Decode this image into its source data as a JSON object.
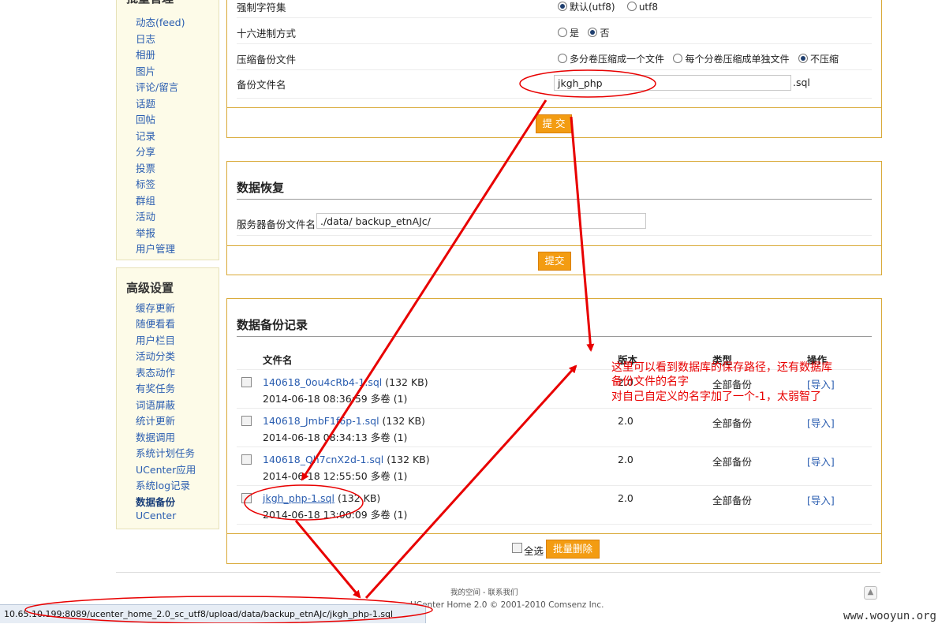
{
  "sidebar": {
    "batch_title": "批量管理",
    "batch_items": [
      "动态(feed)",
      "日志",
      "相册",
      "图片",
      "评论/留言",
      "话题",
      "回帖",
      "记录",
      "分享",
      "投票",
      "标签",
      "群组",
      "活动",
      "举报",
      "用户管理"
    ],
    "advanced_title": "高级设置",
    "advanced_items": [
      "缓存更新",
      "随便看看",
      "用户栏目",
      "活动分类",
      "表态动作",
      "有奖任务",
      "词语屏蔽",
      "统计更新",
      "数据调用",
      "系统计划任务",
      "UCenter应用",
      "系统log记录",
      "数据备份",
      "UCenter"
    ],
    "current_item": "数据备份"
  },
  "backup": {
    "charset_label": "强制字符集",
    "charset_opt1": "默认(utf8)",
    "charset_opt2": "utf8",
    "hex_label": "十六进制方式",
    "hex_yes": "是",
    "hex_no": "否",
    "compress_label": "压缩备份文件",
    "compress_opt1": "多分卷压缩成一个文件",
    "compress_opt2": "每个分卷压缩成单独文件",
    "compress_opt3": "不压缩",
    "filename_label": "备份文件名",
    "filename_value": "jkgh_php",
    "filename_suffix": ".sql",
    "submit": "提 交"
  },
  "restore": {
    "title": "数据恢复",
    "path_label": "服务器备份文件名:",
    "path_value": "./data/ backup_etnAJc/",
    "submit": "提交"
  },
  "records": {
    "title": "数据备份记录",
    "headers": {
      "filename": "文件名",
      "version": "版本",
      "type": "类型",
      "action": "操作"
    },
    "rows": [
      {
        "file": "140618_0ou4cRb4-1.sql",
        "size": "(132 KB)",
        "date": "2014-06-18 08:36:59 多卷 (1)",
        "version": "2.0",
        "type": "全部备份",
        "action": "[导入]"
      },
      {
        "file": "140618_JmbF1f6p-1.sql",
        "size": "(132 KB)",
        "date": "2014-06-18 08:34:13 多卷 (1)",
        "version": "2.0",
        "type": "全部备份",
        "action": "[导入]"
      },
      {
        "file": "140618_Qh7cnX2d-1.sql",
        "size": "(132 KB)",
        "date": "2014-06-18 12:55:50 多卷 (1)",
        "version": "2.0",
        "type": "全部备份",
        "action": "[导入]"
      },
      {
        "file": "jkgh_php-1.sql",
        "size": "(132 KB)",
        "date": "2014-06-18 13:00:09 多卷 (1)",
        "version": "2.0",
        "type": "全部备份",
        "action": "[导入]"
      }
    ],
    "select_all": "全选",
    "batch_delete": "批量删除"
  },
  "footer": {
    "links": "我的空间 - 联系我们",
    "powered": "UCenter Home 2.0 © 2001-2010 Comsenz Inc."
  },
  "status_bar": "10.65.10.199:8089/ucenter_home_2.0_sc_utf8/upload/data/backup_etnAJc/jkgh_php-1.sql",
  "annotation": {
    "line1": "这里可以看到数据库的保存路径，还有数据库",
    "line2": "备份文件的名字",
    "line3": "对自己自定义的名字加了一个-1，太弱智了"
  },
  "watermark": "www.wooyun.org",
  "colors": {
    "accent": "#f39c12",
    "panel_border": "#d9a937",
    "annotation": "#e80000",
    "link": "#2a5db0"
  }
}
